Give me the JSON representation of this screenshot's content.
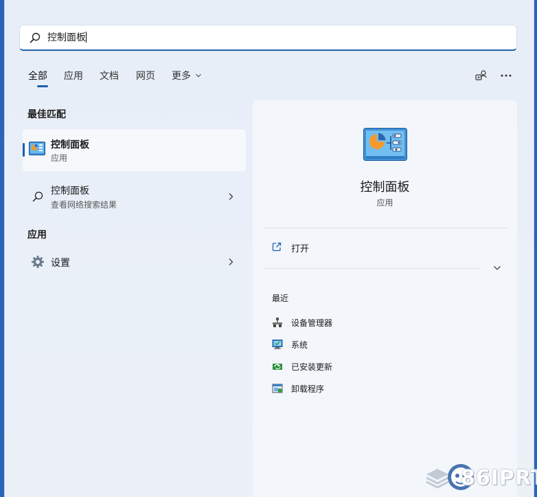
{
  "search": {
    "value": "控制面板"
  },
  "tabs": [
    {
      "label": "全部",
      "active": true
    },
    {
      "label": "应用"
    },
    {
      "label": "文档"
    },
    {
      "label": "网页"
    },
    {
      "label": "更多"
    }
  ],
  "left": {
    "best_match_heading": "最佳匹配",
    "best_match": {
      "title": "控制面板",
      "subtitle": "应用"
    },
    "web_result": {
      "title": "控制面板",
      "subtitle": "查看网络搜索结果"
    },
    "apps_heading": "应用",
    "apps": [
      {
        "title": "设置"
      }
    ]
  },
  "detail": {
    "title": "控制面板",
    "subtitle": "应用",
    "open_label": "打开",
    "recent_heading": "最近",
    "recent": [
      {
        "label": "设备管理器",
        "icon": "device-manager-icon"
      },
      {
        "label": "系统",
        "icon": "system-icon"
      },
      {
        "label": "已安装更新",
        "icon": "installed-updates-icon"
      },
      {
        "label": "卸载程序",
        "icon": "uninstall-program-icon"
      }
    ]
  },
  "watermark": {
    "text": "86IPRT"
  },
  "colors": {
    "accent": "#1c5fab",
    "panel_bg": "#e9eff8",
    "card_bg": "#f6f8fb"
  }
}
